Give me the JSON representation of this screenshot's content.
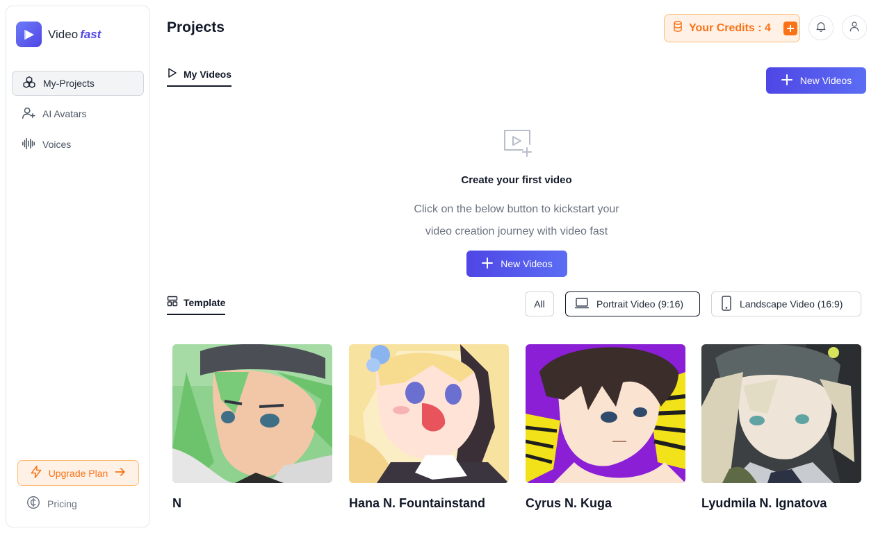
{
  "brand": {
    "name": "Video",
    "suffix": "fast"
  },
  "sidebar": {
    "items": [
      {
        "label": "My-Projects",
        "icon": "cubes-icon",
        "active": true
      },
      {
        "label": "AI Avatars",
        "icon": "user-plus-icon",
        "active": false
      },
      {
        "label": "Voices",
        "icon": "audio-wave-icon",
        "active": false
      }
    ],
    "upgrade_label": "Upgrade Plan",
    "pricing_label": "Pricing"
  },
  "header": {
    "title": "Projects",
    "credits_label": "Your Credits : 4",
    "icons": [
      "bell-icon",
      "user-icon"
    ]
  },
  "videos": {
    "tab_label": "My Videos",
    "new_button_label": "New Videos",
    "empty_title": "Create your first video",
    "empty_line1": "Click on the below button to kickstart your",
    "empty_line2": "video creation journey with video fast",
    "empty_button_label": "New Videos"
  },
  "templates": {
    "tab_label": "Template",
    "filters": [
      {
        "label": "All",
        "selected": false
      },
      {
        "label": "Portrait Video (9:16)",
        "selected": true,
        "icon": "laptop-icon"
      },
      {
        "label": "Landscape Video (16:9)",
        "selected": false,
        "icon": "phone-icon"
      }
    ],
    "cards": [
      {
        "name": "N"
      },
      {
        "name": "Hana N. Fountainstand"
      },
      {
        "name": "Cyrus N. Kuga"
      },
      {
        "name": "Lyudmila N. Ignatova"
      }
    ]
  },
  "colors": {
    "accent": "#4f46e5",
    "orange": "#f97316",
    "orange_bg": "#fff1e6"
  }
}
